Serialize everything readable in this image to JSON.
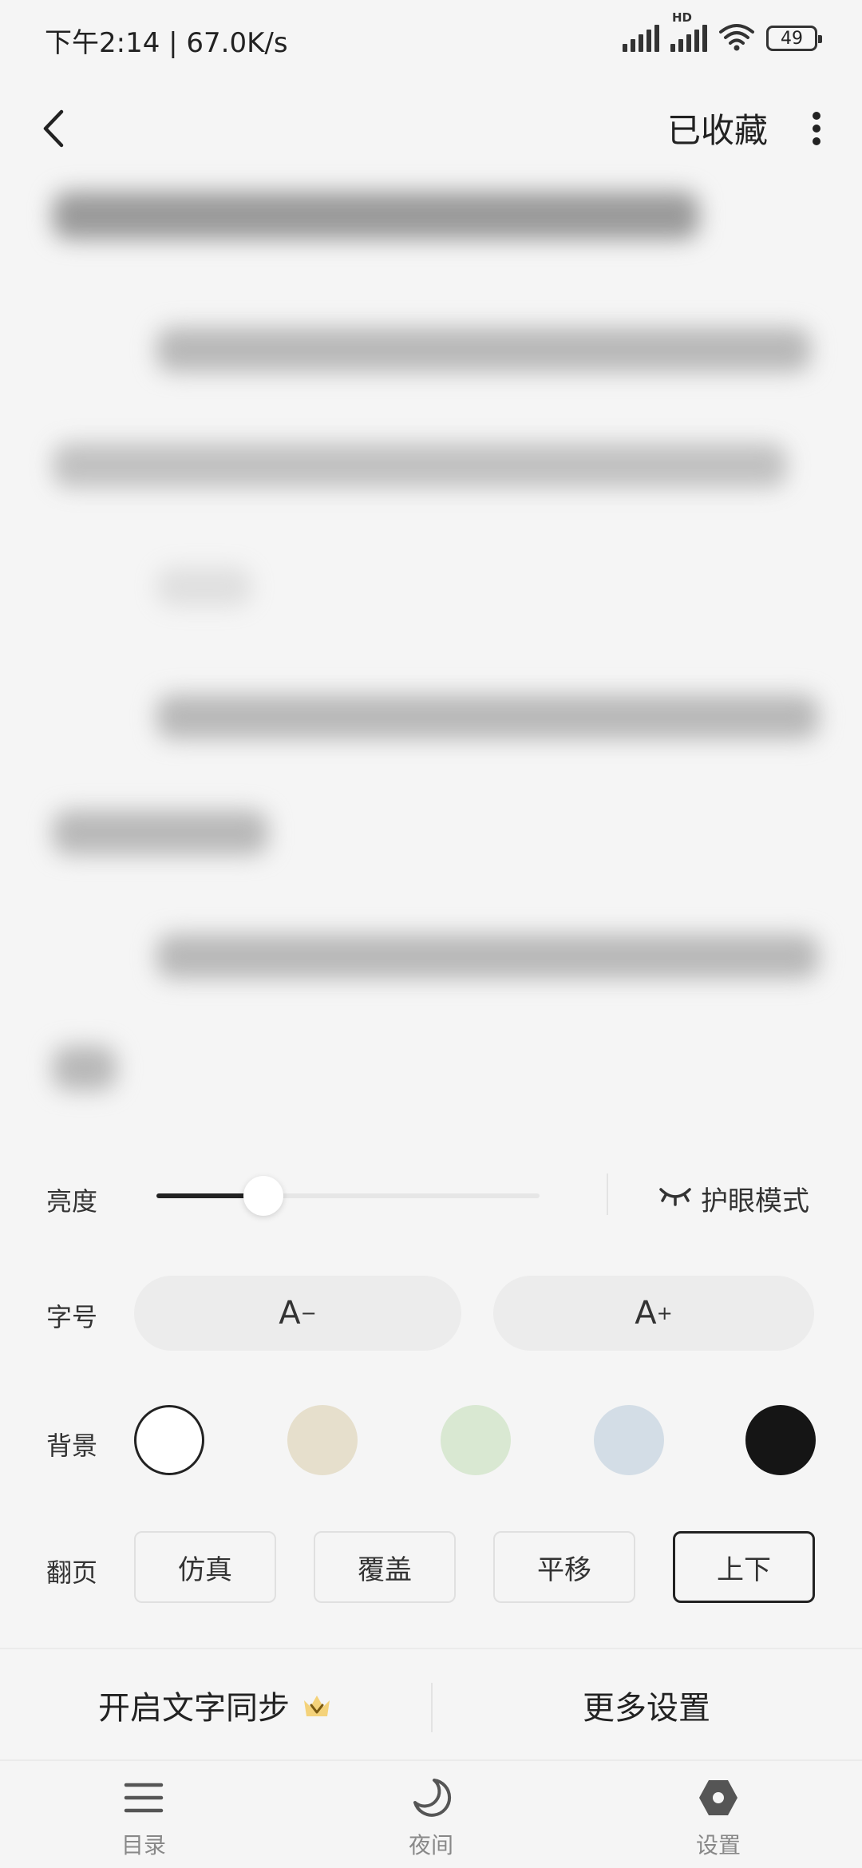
{
  "status_bar": {
    "text": "下午2:14 | 67.0K/s",
    "hd_label": "HD",
    "battery": "49"
  },
  "header": {
    "collect_label": "已收藏",
    "back_icon": "chevron-left-icon",
    "more_icon": "more-vertical-icon"
  },
  "settings": {
    "brightness": {
      "label": "亮度",
      "value": 0.28,
      "eye_mode_label": "护眼模式"
    },
    "font_size": {
      "label": "字号",
      "decrease": "A",
      "decrease_sup": "−",
      "increase": "A",
      "increase_sup": "+"
    },
    "background": {
      "label": "背景",
      "colors": [
        "#ffffff",
        "#e6dfcc",
        "#d9e8d2",
        "#d3dde6",
        "#151515"
      ],
      "selected_index": 0
    },
    "page_turn": {
      "label": "翻页",
      "options": [
        "仿真",
        "覆盖",
        "平移",
        "上下"
      ],
      "selected_index": 3
    },
    "sync_label": "开启文字同步",
    "more_settings_label": "更多设置"
  },
  "tabbar": {
    "items": [
      {
        "label": "目录",
        "icon": "menu-icon"
      },
      {
        "label": "夜间",
        "icon": "moon-icon"
      },
      {
        "label": "设置",
        "icon": "settings-icon"
      }
    ]
  }
}
